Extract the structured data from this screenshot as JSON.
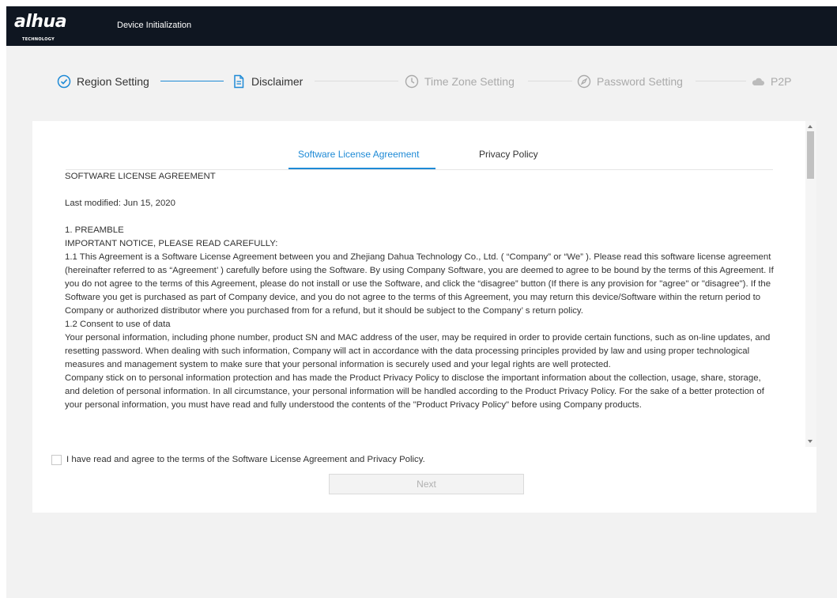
{
  "header": {
    "logo": "alhua",
    "logo_sub": "TECHNOLOGY",
    "title": "Device Initialization"
  },
  "stepper": {
    "steps": [
      {
        "label": "Region Setting",
        "state": "done",
        "icon": "check-circle-icon"
      },
      {
        "label": "Disclaimer",
        "state": "active",
        "icon": "document-icon"
      },
      {
        "label": "Time Zone Setting",
        "state": "pending",
        "icon": "clock-icon"
      },
      {
        "label": "Password Setting",
        "state": "pending",
        "icon": "compass-icon"
      },
      {
        "label": "P2P",
        "state": "pending",
        "icon": "cloud-icon"
      }
    ]
  },
  "tabs": {
    "license": "Software License Agreement",
    "privacy": "Privacy Policy",
    "active": "license"
  },
  "document": {
    "title": "SOFTWARE LICENSE AGREEMENT",
    "modified": "Last modified: Jun 15, 2020",
    "preamble_heading": "1. PREAMBLE",
    "notice": "IMPORTANT NOTICE, PLEASE READ CAREFULLY:",
    "p1_1": "1.1 This Agreement is a Software License Agreement between you and Zhejiang Dahua Technology Co., Ltd. ( “Company”  or  “We” ). Please read this software license agreement (hereinafter referred to as  “Agreement’ ) carefully before using the Software. By using Company Software, you are deemed to agree to be bound by the terms of this Agreement. If you do not agree to the terms of this Agreement, please do not install or use the Software, and click the  “disagree” button (If there is any provision for \"agree\" or \"disagree\"). If the Software you get is purchased as part of Company device, and you do not agree to the terms of this Agreement, you may return this device/Software within the return period to Company or authorized distributor where you purchased from for a refund, but it should be subject to the Company’ s return policy.",
    "consent_heading": "1.2 Consent to use of data",
    "p1_2": "Your personal information, including phone number, product SN and MAC address of the user, may be required in order to provide certain functions, such as on-line updates, and resetting password. When dealing with such information, Company will act in accordance with the data processing principles provided by law and using proper technological measures and management system to make sure that your personal information is securely used and your legal rights are well protected.",
    "p1_3": "Company stick on to personal information protection and has made the Product Privacy Policy to disclose the important information about the collection, usage, share, storage, and deletion of personal information. In all circumstance, your personal information will be handled according to the Product Privacy Policy. For the sake of a better protection of your personal information, you must have read and fully understood the contents of the \"Product Privacy Policy\" before using Company products."
  },
  "agreement": {
    "checkbox_label": "I have read and agree to the terms of the Software License Agreement and Privacy Policy.",
    "checked": false
  },
  "next_button": "Next",
  "colors": {
    "accent": "#1e8ad6",
    "header_bg": "#0f1621",
    "page_bg": "#f2f2f2"
  }
}
